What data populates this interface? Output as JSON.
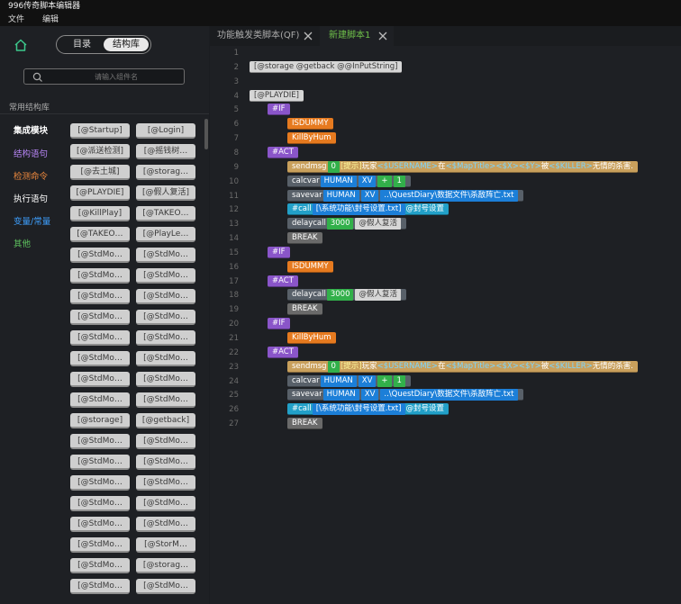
{
  "window": {
    "title": "996传奇脚本编辑器"
  },
  "menu": [
    "文件",
    "编辑"
  ],
  "sidebar": {
    "segments": [
      "目录",
      "结构库"
    ],
    "search_placeholder": "请输入组件名",
    "section_title": "常用结构库",
    "categories": [
      {
        "label": "集成模块",
        "color": "#ffffff",
        "active": true
      },
      {
        "label": "结构语句",
        "color": "#b785f5"
      },
      {
        "label": "检测命令",
        "color": "#f08a3e"
      },
      {
        "label": "执行语句",
        "color": "#ffffff"
      },
      {
        "label": "变量/常量",
        "color": "#3ea0ff"
      },
      {
        "label": "其他",
        "color": "#5fc45f"
      }
    ],
    "chips": [
      [
        "[@Startup]",
        "[@Login]"
      ],
      [
        "[@派送检测]",
        "[@摇钱树…"
      ],
      [
        "[@去土城]",
        "[@storag…"
      ],
      [
        "[@PLAYDIE]",
        "[@假人复活]"
      ],
      [
        "[@KillPlay]",
        "[@TAKEO…"
      ],
      [
        "[@TAKEO…",
        "[@PlayLe…"
      ],
      [
        "[@StdMo…",
        "[@StdMo…"
      ],
      [
        "[@StdMo…",
        "[@StdMo…"
      ],
      [
        "[@StdMo…",
        "[@StdMo…"
      ],
      [
        "[@StdMo…",
        "[@StdMo…"
      ],
      [
        "[@StdMo…",
        "[@StdMo…"
      ],
      [
        "[@StdMo…",
        "[@StdMo…"
      ],
      [
        "[@StdMo…",
        "[@StdMo…"
      ],
      [
        "[@StdMo…",
        "[@StdMo…"
      ],
      [
        "[@storage]",
        "[@getback]"
      ],
      [
        "[@StdMo…",
        "[@StdMo…"
      ],
      [
        "[@StdMo…",
        "[@StdMo…"
      ],
      [
        "[@StdMo…",
        "[@StdMo…"
      ],
      [
        "[@StdMo…",
        "[@StdMo…"
      ],
      [
        "[@StdMo…",
        "[@StdMo…"
      ],
      [
        "[@StdMo…",
        "[@StorM…"
      ],
      [
        "[@StdMo…",
        "[@storag…"
      ],
      [
        "[@StdMo…",
        "[@StdMo…"
      ]
    ]
  },
  "tabs": [
    {
      "label": "功能触发类脚本(QF)",
      "active": false
    },
    {
      "label": "新建脚本1",
      "active": true
    }
  ],
  "code": {
    "lines": [
      "1",
      "2",
      "3",
      "4",
      "5",
      "6",
      "7",
      "8",
      "9",
      "10",
      "11",
      "12",
      "13",
      "14",
      "15",
      "16",
      "17",
      "18",
      "19",
      "20",
      "21",
      "22",
      "23",
      "24",
      "25",
      "26",
      "27"
    ],
    "line2": "[@storage @getback @@InPutString]",
    "line4": "[@PLAYDIE]",
    "if_label": "#IF",
    "act_label": "#ACT",
    "isdummy": "ISDUMMY",
    "killbyhum": "KillByHum",
    "sendmsg": "sendmsg",
    "zero": "0",
    "msg_p1": "[提示]",
    "msg_p2": "玩家",
    "msg_p3": "<$USERNAME>",
    "msg_p4": "在",
    "msg_p5": "<$MapTitle>",
    "msg_p6": "<$X>",
    "msg_p7": "<$Y>",
    "msg_p8": "被",
    "msg_p9": "<$KILLER>",
    "msg_p10": "无情的杀害.",
    "calcvar": "calcvar",
    "human": "HUMAN",
    "xv": "XV",
    "plus": "+",
    "one": "1",
    "savevar": "savevar",
    "savepath": "..\\QuestDiary\\数据文件\\杀敌阵亡.txt",
    "call": "#call",
    "callpath": "[\\系统功能\\封号设置.txt]",
    "calllabel": "@封号设置",
    "delaycall": "delaycall",
    "d3000": "3000",
    "fuhuo": "@假人复活",
    "brk": "BREAK"
  }
}
